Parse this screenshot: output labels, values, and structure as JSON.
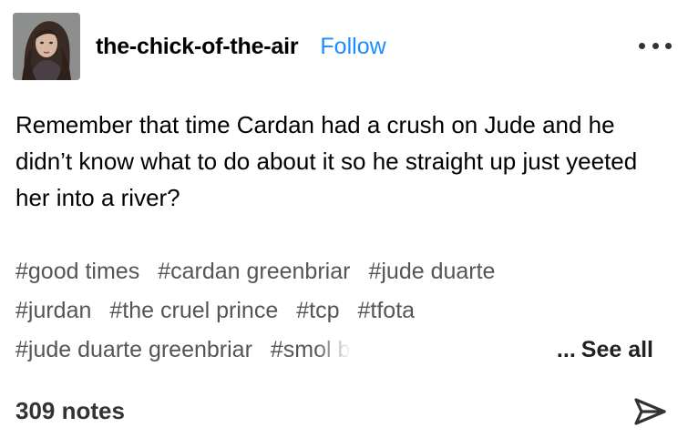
{
  "post": {
    "blog_name": "the-chick-of-the-air",
    "follow_label": "Follow",
    "more_icon": "ellipsis-horizontal-icon",
    "body": "Remember that time Cardan had a crush on Jude and he didn’t know what to do about it so he straight up just yeeted her into a river?",
    "tags_row1": [
      "#good times",
      "#cardan greenbriar",
      "#jude duarte"
    ],
    "tags_row2": [
      "#jurdan",
      "#the cruel prince",
      "#tcp",
      "#tfota"
    ],
    "tags_row3": [
      "#jude duarte greenbriar",
      "#smol bean cardan"
    ],
    "ellipsis": "...",
    "see_all_label": "See all",
    "notes_label": "309 notes",
    "share_icon": "share-send-icon"
  },
  "colors": {
    "follow": "#1a8cff",
    "tag_text": "#555555",
    "text": "#000000"
  }
}
